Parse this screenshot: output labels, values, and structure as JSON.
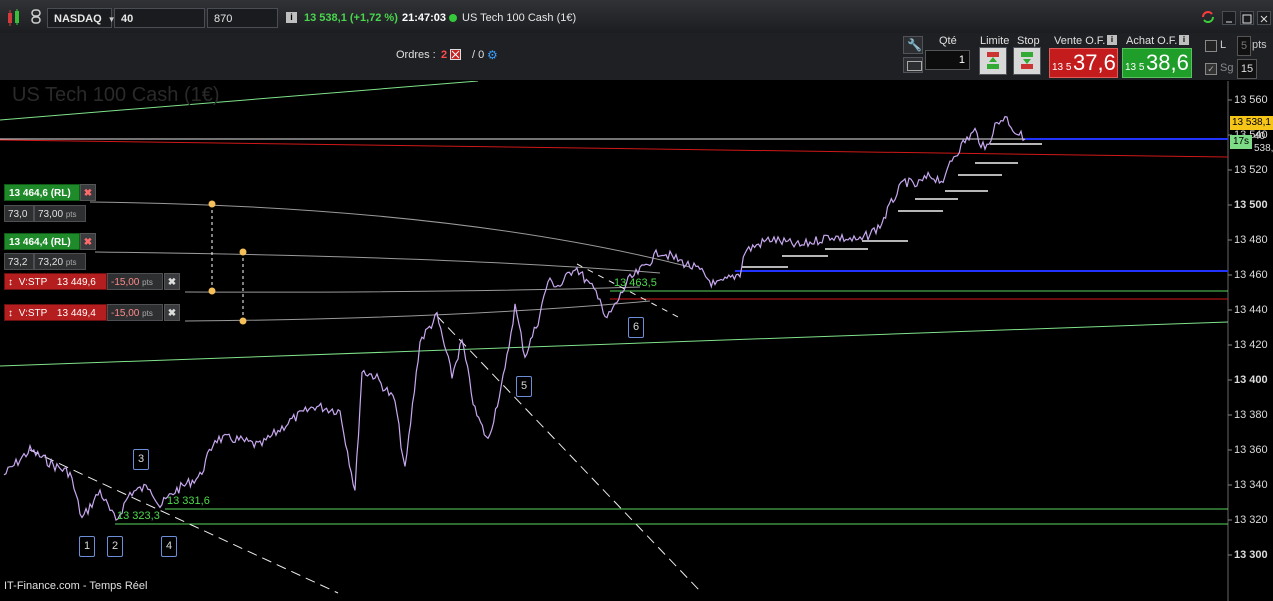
{
  "toolbar": {
    "instrument": "NASDAQ",
    "interval": "40 secondes",
    "units": "870 unités",
    "price_change": "13 538,1 (+1,72 %)",
    "time": "21:47:03",
    "product": "US Tech 100 Cash (1€)"
  },
  "orders": {
    "label": "Ordres :",
    "count_open": "2",
    "slash_label": "/ 0"
  },
  "trade_panel": {
    "qty_label": "Qté",
    "qty_value": "1",
    "limit_label": "Limite",
    "stop_label": "Stop",
    "sell_label": "Vente O.F.",
    "buy_label": "Achat O.F.",
    "sell_small": "13 5",
    "sell_big": "37,6",
    "buy_small": "13 5",
    "buy_big": "38,6",
    "l_label": "L",
    "pts_value": "5",
    "pts_label": "pts",
    "sg_label": "Sg",
    "sg_value": "15"
  },
  "chart": {
    "watermark": "US Tech 100 Cash (1€)",
    "footer": "IT-Finance.com - Temps Réel",
    "price_axis": [
      "13 560",
      "13 540",
      "13 520",
      "13 500",
      "13 480",
      "13 460",
      "13 440",
      "13 420",
      "13 400",
      "13 380",
      "13 360",
      "13 340",
      "13 320",
      "13 300"
    ],
    "current_price_tag": "13 538,1",
    "countdown_tag": "17s",
    "tag_540_suffix": "40",
    "tag_538_suffix": "538,1",
    "orders": [
      {
        "price_label": "13 464,6 (RL)",
        "pts_a": "73,0",
        "pts_b": "73,00",
        "pts_unit": "pts"
      },
      {
        "price_label": "13 464,4 (RL)",
        "pts_a": "73,2",
        "pts_b": "73,20",
        "pts_unit": "pts"
      }
    ],
    "stops": [
      {
        "type": "V:STP",
        "price": "13 449,6",
        "offset": "-15,00",
        "unit": "pts"
      },
      {
        "type": "V:STP",
        "price": "13 449,4",
        "offset": "-15,00",
        "unit": "pts"
      }
    ],
    "level_labels": [
      "13 323,3",
      "13 331,6",
      "13 463,5"
    ],
    "wave_labels": [
      "1",
      "2",
      "3",
      "4",
      "5",
      "6"
    ],
    "colors": {
      "candle": "#c8a8f0",
      "blue_line": "#1a2bff",
      "red_line": "#d01818",
      "green_line": "#58d35a",
      "level_text": "#4cdc4c",
      "sell_bg": "#c41c1c",
      "buy_bg": "#1f9e2a"
    }
  }
}
